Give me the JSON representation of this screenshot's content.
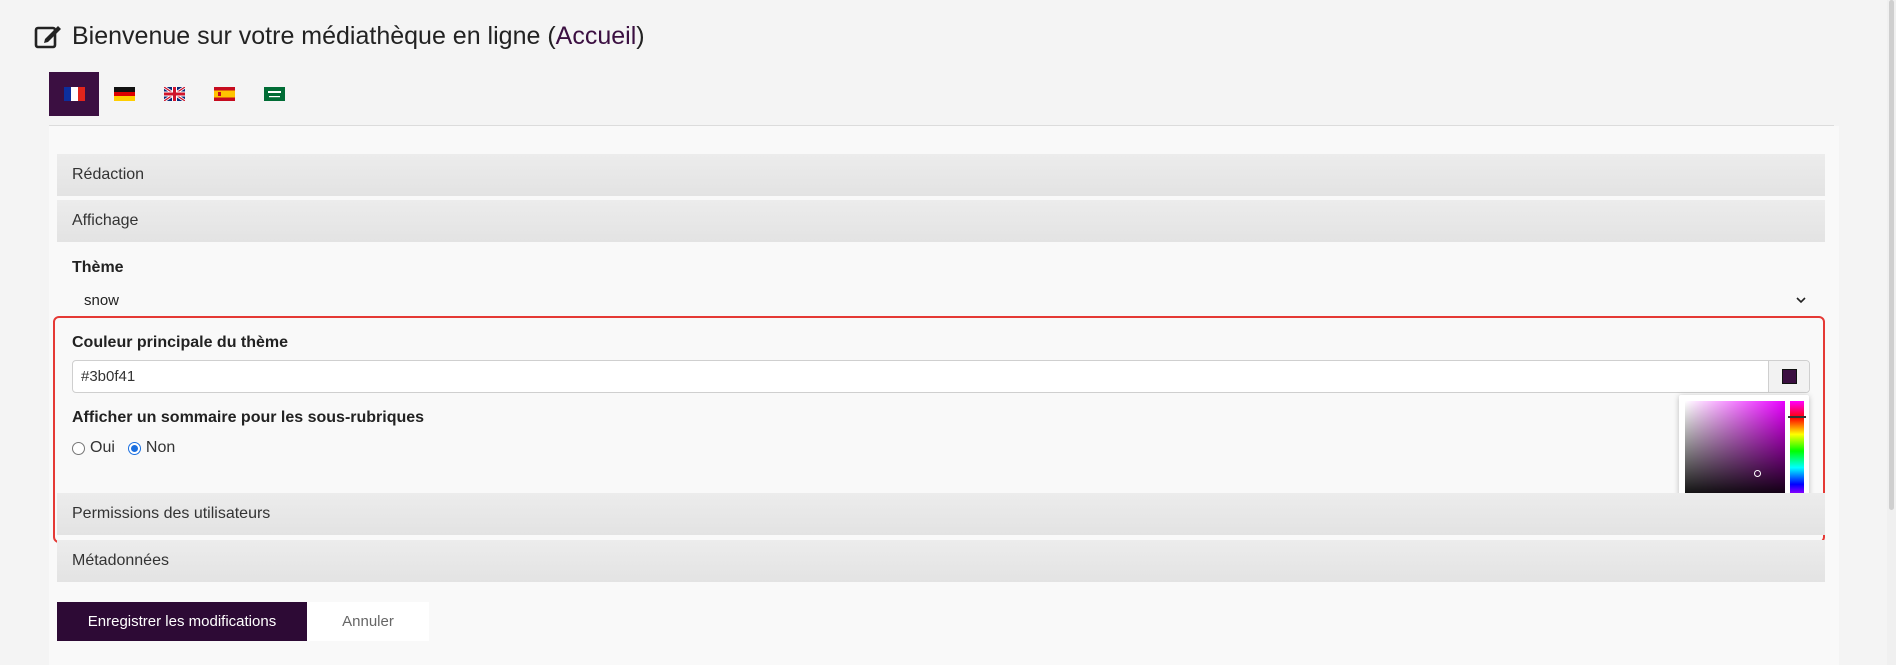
{
  "page": {
    "title_prefix": "Bienvenue sur votre médiathèque en ligne (",
    "title_link": "Accueil",
    "title_suffix": ")"
  },
  "languages": [
    {
      "code": "fr",
      "icon": "flag-france-icon",
      "active": true
    },
    {
      "code": "de",
      "icon": "flag-germany-icon",
      "active": false
    },
    {
      "code": "en",
      "icon": "flag-uk-icon",
      "active": false
    },
    {
      "code": "es",
      "icon": "flag-spain-icon",
      "active": false
    },
    {
      "code": "ar",
      "icon": "flag-saudi-arabia-icon",
      "active": false
    }
  ],
  "sections": {
    "redaction": "Rédaction",
    "affichage": "Affichage",
    "permissions": "Permissions des utilisateurs",
    "metadonnees": "Métadonnées"
  },
  "form": {
    "theme_label": "Thème",
    "theme_value": "snow",
    "color_label": "Couleur principale du thème",
    "color_value": "#3b0f41",
    "summary_label": "Afficher un sommaire pour les sous-rubriques",
    "radio_yes": "Oui",
    "radio_no": "Non",
    "summary_selected": "Non"
  },
  "actions": {
    "save": "Enregistrer les modifications",
    "cancel": "Annuler"
  },
  "colors": {
    "accent": "#3b0f41",
    "highlight_border": "#e53935",
    "radio_checked": "#1a6fe0"
  }
}
